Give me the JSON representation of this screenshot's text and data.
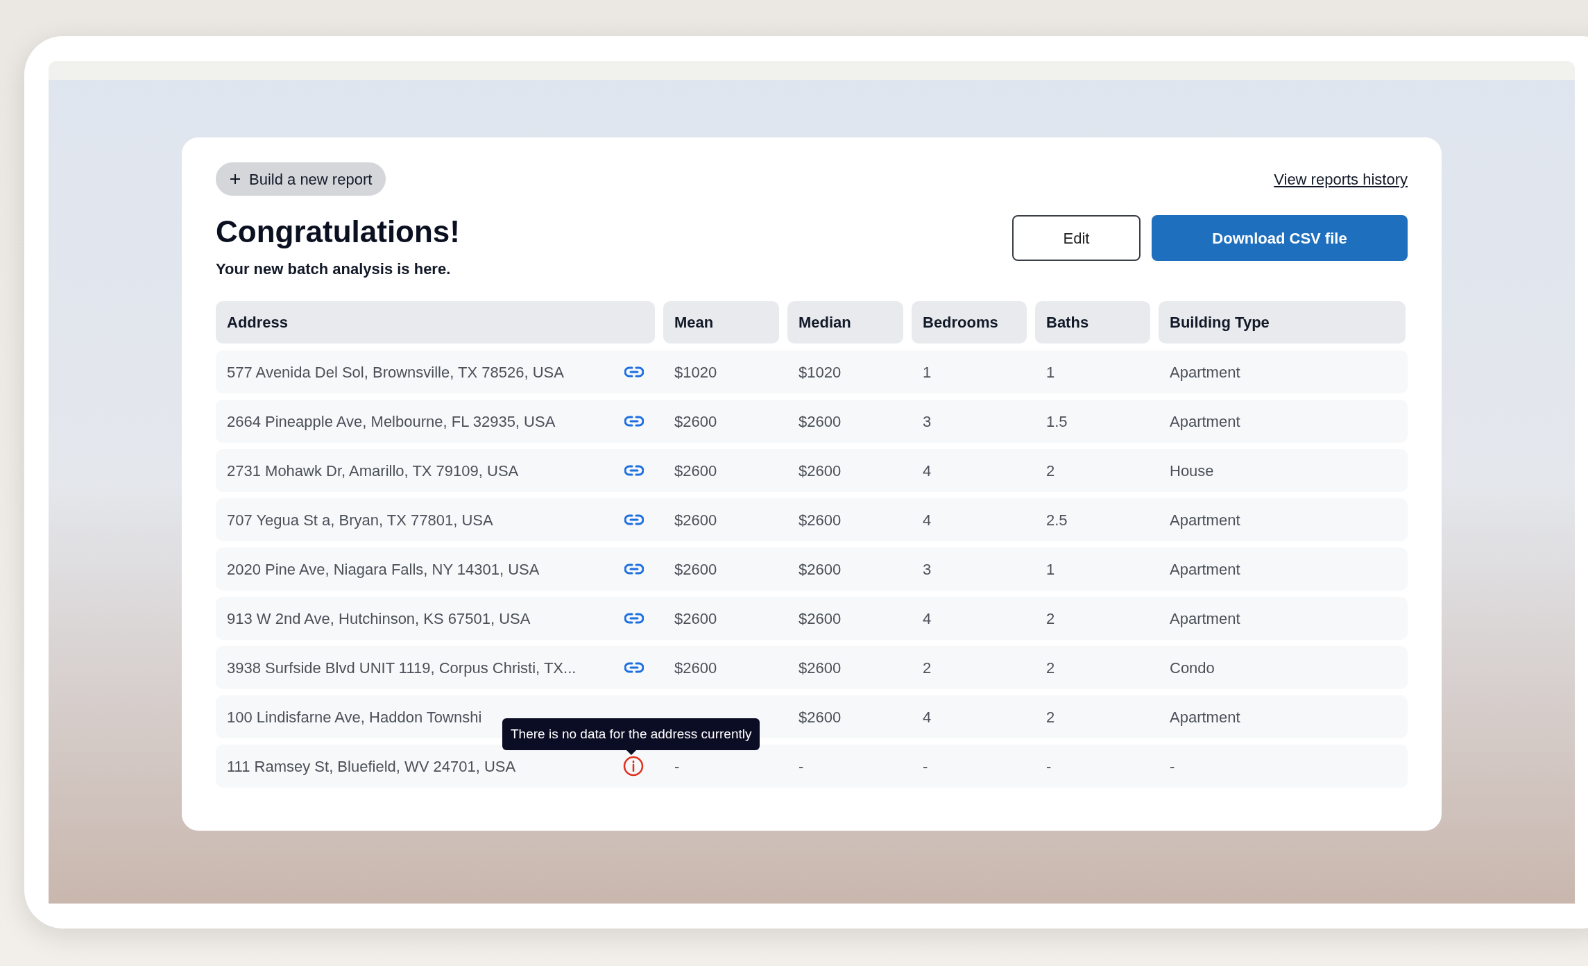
{
  "new_report_button": {
    "label": "Build a new report"
  },
  "history_link": {
    "label": "View reports history"
  },
  "heading": {
    "title": "Congratulations!",
    "subtitle": "Your new batch analysis is here."
  },
  "actions": [
    {
      "label": "Edit",
      "kind": "secondary"
    },
    {
      "label": "Download CSV file",
      "kind": "primary"
    }
  ],
  "table": {
    "columns": [
      "Address",
      "Mean",
      "Median",
      "Bedrooms",
      "Baths",
      "Building Type"
    ],
    "rows": [
      {
        "address": "577 Avenida Del Sol, Brownsville, TX 78526, USA",
        "kind": "link",
        "mean": "$1020",
        "median": "$1020",
        "bedrooms": "1",
        "baths": "1",
        "type": "Apartment"
      },
      {
        "address": "2664 Pineapple Ave, Melbourne, FL 32935, USA",
        "kind": "link",
        "mean": "$2600",
        "median": "$2600",
        "bedrooms": "3",
        "baths": "1.5",
        "type": "Apartment"
      },
      {
        "address": "2731 Mohawk Dr, Amarillo, TX 79109, USA",
        "kind": "link",
        "mean": "$2600",
        "median": "$2600",
        "bedrooms": "4",
        "baths": "2",
        "type": "House"
      },
      {
        "address": "707 Yegua St a, Bryan, TX 77801, USA",
        "kind": "link",
        "mean": "$2600",
        "median": "$2600",
        "bedrooms": "4",
        "baths": "2.5",
        "type": "Apartment"
      },
      {
        "address": "2020 Pine Ave, Niagara Falls, NY 14301, USA",
        "kind": "link",
        "mean": "$2600",
        "median": "$2600",
        "bedrooms": "3",
        "baths": "1",
        "type": "Apartment"
      },
      {
        "address": "913 W 2nd Ave, Hutchinson, KS 67501, USA",
        "kind": "link",
        "mean": "$2600",
        "median": "$2600",
        "bedrooms": "4",
        "baths": "2",
        "type": "Apartment"
      },
      {
        "address": "3938 Surfside Blvd UNIT 1119, Corpus Christi, TX...",
        "kind": "link",
        "mean": "$2600",
        "median": "$2600",
        "bedrooms": "2",
        "baths": "2",
        "type": "Condo"
      },
      {
        "address": "100 Lindisfarne Ave, Haddon Townshi",
        "median": "$2600",
        "bedrooms": "4",
        "baths": "2",
        "type": "Apartment"
      },
      {
        "address": "111 Ramsey St, Bluefield, WV 24701, USA",
        "kind": "info",
        "tooltip": "There is no data for the address currently",
        "mean": "-",
        "median": "-",
        "bedrooms": "-",
        "baths": "-",
        "type": "-"
      }
    ]
  }
}
